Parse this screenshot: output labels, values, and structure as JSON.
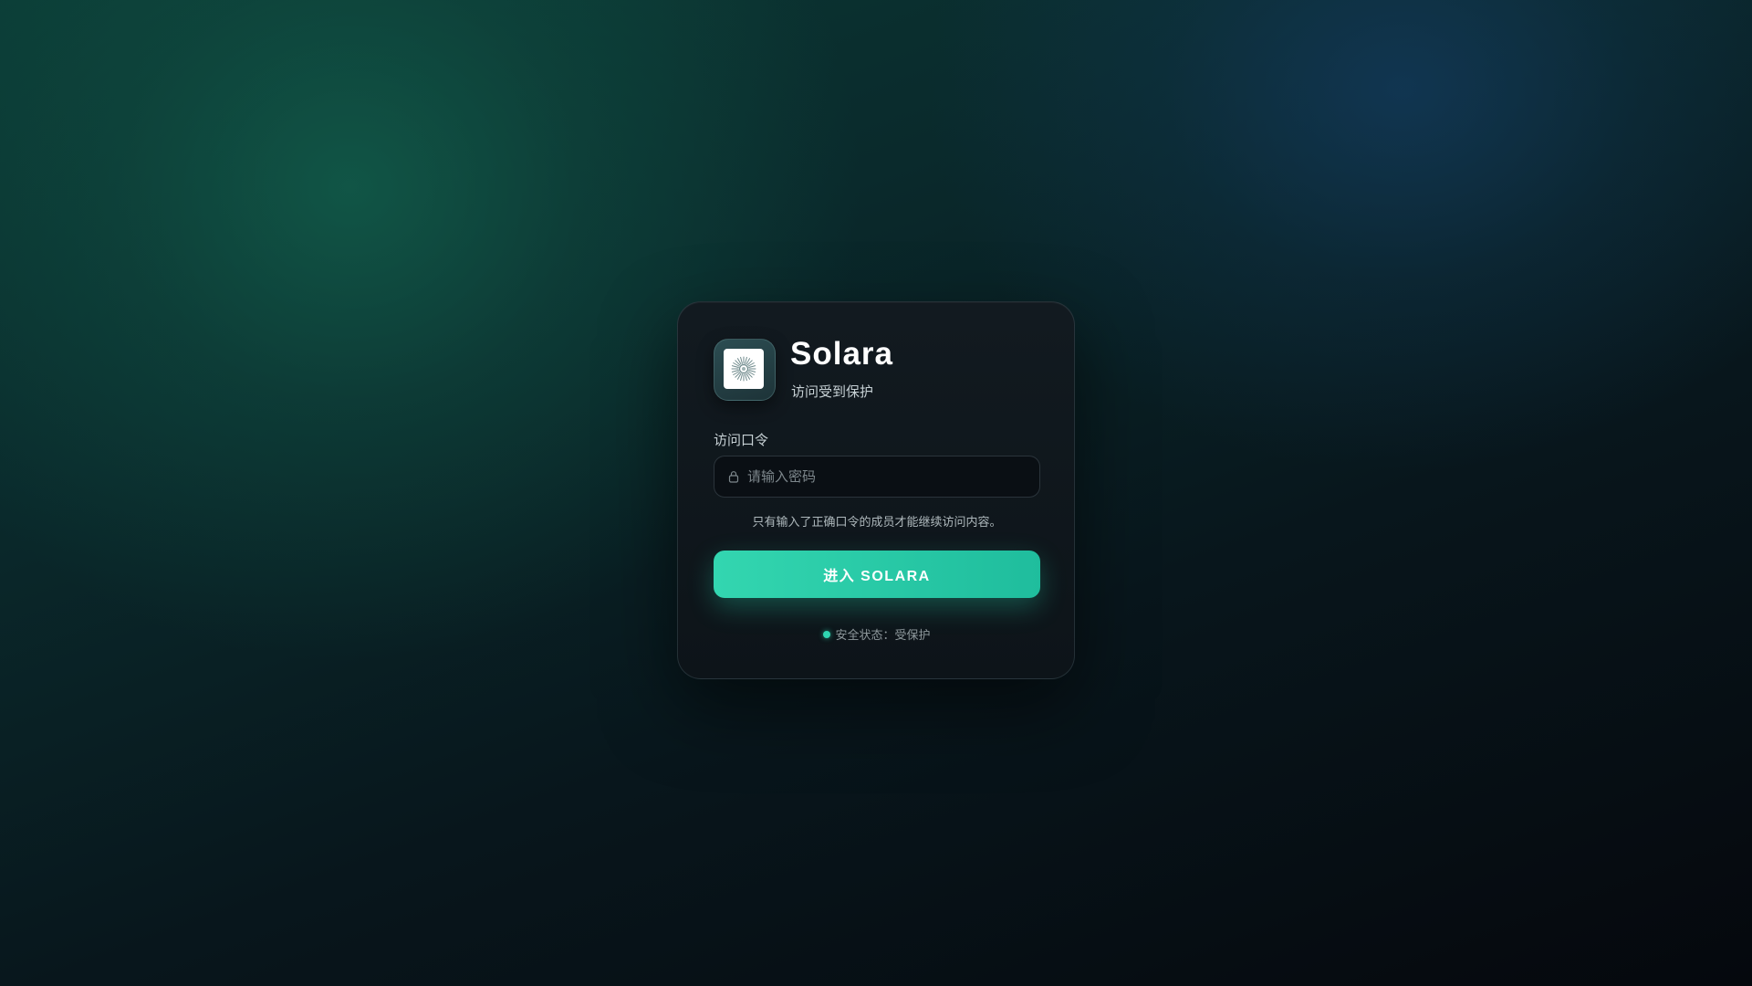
{
  "brand": {
    "title": "Solara",
    "subtitle": "访问受到保护",
    "logo_icon": "sun-burst-icon"
  },
  "form": {
    "label": "访问口令",
    "placeholder": "请输入密码",
    "value": "",
    "input_icon": "lock-icon",
    "hint": "只有输入了正确口令的成员才能继续访问内容。",
    "submit_label": "进入 SOLARA"
  },
  "status": {
    "label": "安全状态：",
    "value": "受保护",
    "indicator_color": "#2fd6b1"
  },
  "colors": {
    "accent": "#2fd6b1",
    "button_gradient_start": "#33d6b0",
    "button_gradient_end": "#1fbd9d",
    "card_background": "#10171c"
  }
}
